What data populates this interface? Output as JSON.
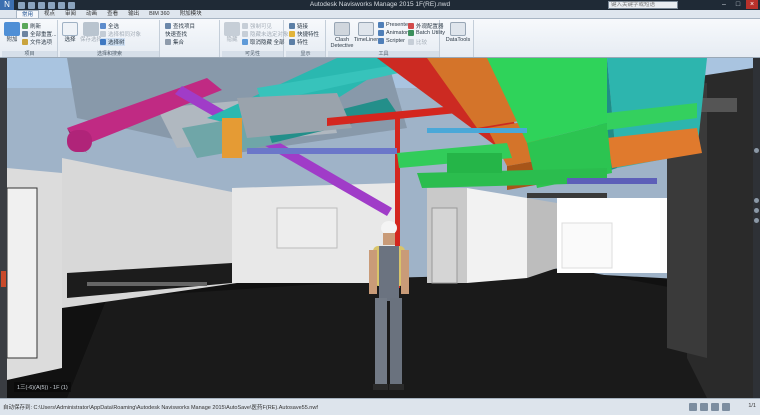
{
  "window": {
    "title": "Autodesk Navisworks Manage 2015",
    "file_name": "1F(RE).nwd",
    "search_placeholder": "键入关键字或短语"
  },
  "tabs": [
    "常用",
    "视点",
    "审阅",
    "动画",
    "查看",
    "输出",
    "BIM 360",
    "附加模块"
  ],
  "active_tab": 0,
  "ribbon": {
    "project": {
      "label": "项目",
      "append": "附加",
      "refresh": "刷新",
      "reset_all": "全部重置...",
      "file_options": "文件选项"
    },
    "select_search": {
      "label": "选择和搜索",
      "select": "选择",
      "save_selection": "保存选择",
      "select_all": "全选",
      "select_same": "选择相同对象",
      "selection_tree": "选择树",
      "find_items": "查找项目",
      "quick_find": "快速查找",
      "sets": "集合"
    },
    "visibility": {
      "label": "可见性",
      "hide": "隐藏",
      "require": "强制可见",
      "hide_unselected": "隐藏未选定对象",
      "unhide_all": "取消隐藏 全部"
    },
    "display": {
      "label": "显示",
      "links": "链接",
      "quick_properties": "快捷特性",
      "properties": "特性"
    },
    "tools": {
      "label": "工具",
      "clash_detective": "Clash Detective",
      "timeliner": "TimeLiner",
      "presenter": "Presenter",
      "animator": "Animator",
      "scripter": "Scripter",
      "appearance_profiler": "外观配置器",
      "batch_utility": "Batch Utility",
      "compare": "比较",
      "datatools": "DataTools"
    }
  },
  "viewport": {
    "coord_readout": "1三(-6)(A(5)) - 1F (1)"
  },
  "status": {
    "message": "自动保存到: C:\\Users\\Administrator\\AppData\\Roaming\\Autodesk Navisworks Manage 2015\\AutoSave\\医药F(RE).Autosave55.nwf",
    "page": "1/1"
  },
  "colors": {
    "duct_green": "#2fd35a",
    "duct_teal": "#2ab8b0",
    "duct_orange": "#d4742a",
    "pipe_magenta": "#c02a83",
    "pipe_red": "#d4261e",
    "pipe_purple": "#a03cc8"
  }
}
